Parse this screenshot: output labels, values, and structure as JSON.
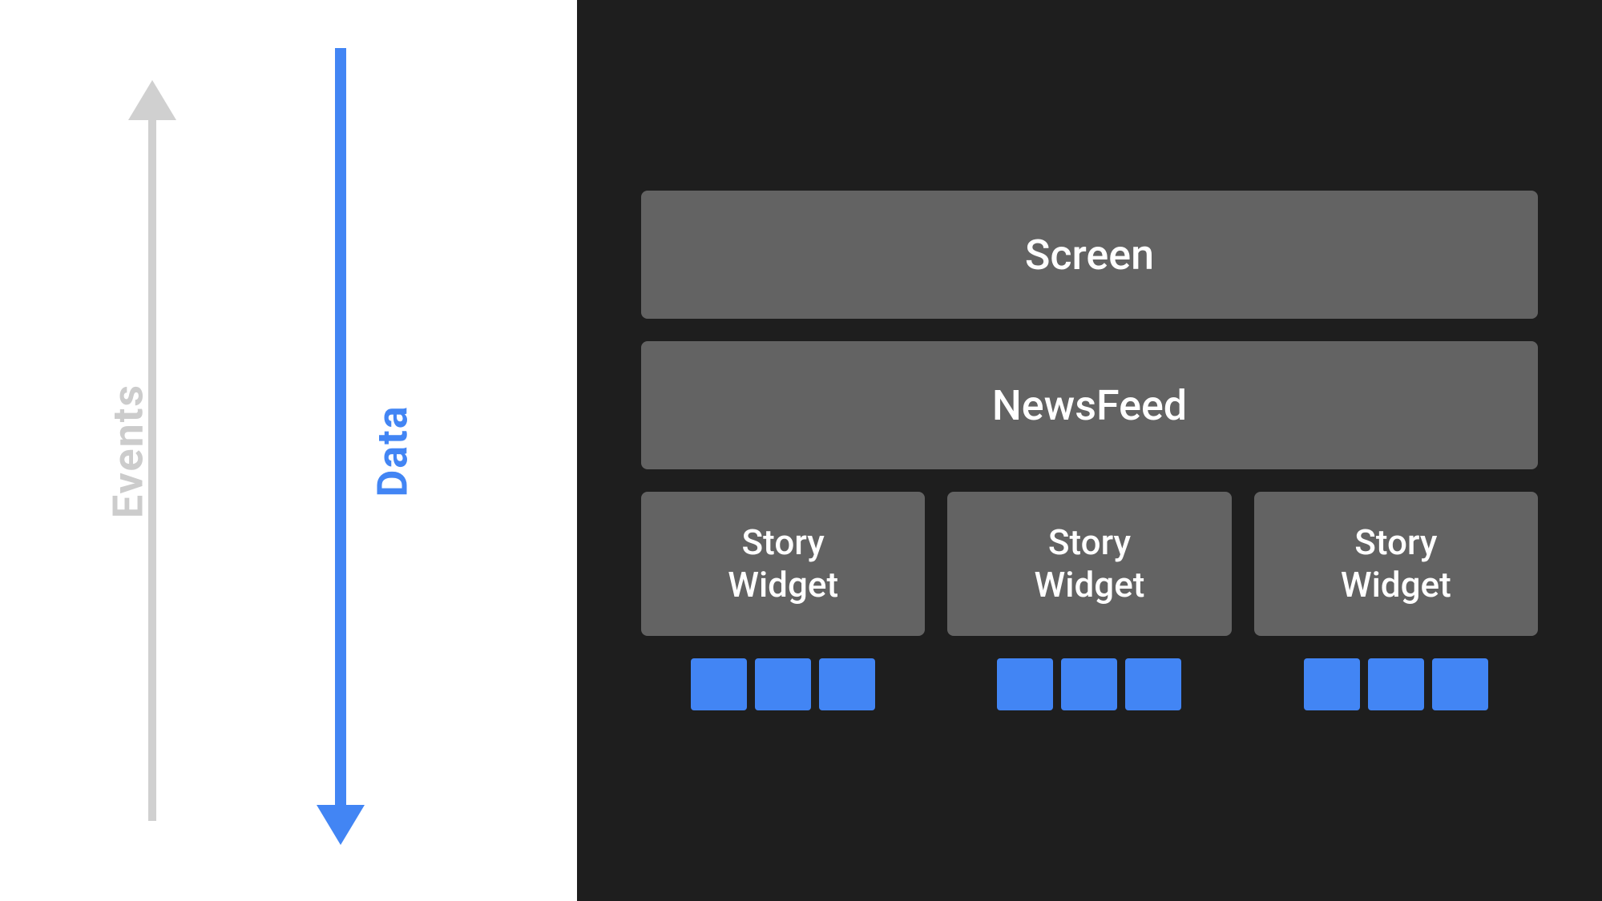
{
  "left": {
    "events_label": "Events",
    "data_label": "Data"
  },
  "right": {
    "screen_label": "Screen",
    "newsfeed_label": "NewsFeed",
    "story_widgets": [
      {
        "label": "Story\nWidget"
      },
      {
        "label": "Story\nWidget"
      },
      {
        "label": "Story\nWidget"
      }
    ],
    "mini_groups": [
      {
        "blocks": 3
      },
      {
        "blocks": 3
      },
      {
        "blocks": 3
      }
    ]
  },
  "colors": {
    "blue": "#4285f4",
    "dark_bg": "#1e1e1e",
    "gray_block": "#636363",
    "white": "#ffffff",
    "light_gray_arrow": "#d0d0d0"
  }
}
